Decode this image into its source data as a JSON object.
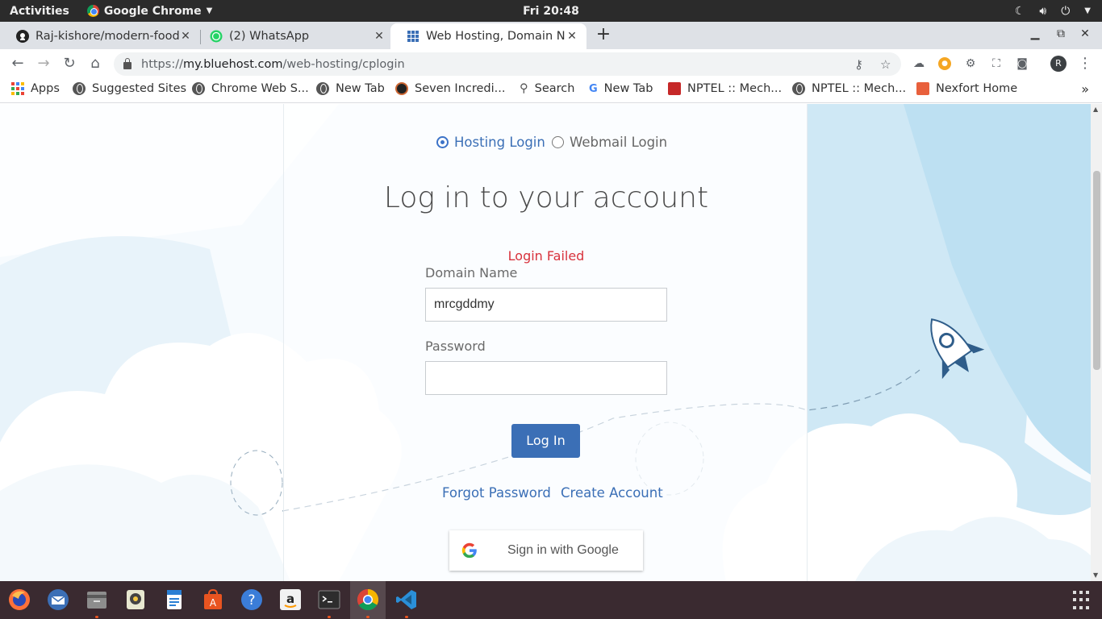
{
  "system_bar": {
    "activities": "Activities",
    "app_name": "Google Chrome",
    "clock": "Fri 20:48"
  },
  "tabs": [
    {
      "title": "Raj-kishore/modern-food",
      "icon": "github-icon"
    },
    {
      "title": "(2) WhatsApp",
      "icon": "whatsapp-icon"
    },
    {
      "title": "Web Hosting, Domain Na",
      "icon": "bluehost-icon",
      "active": true
    }
  ],
  "address_bar": {
    "scheme": "https://",
    "host": "my.bluehost.com",
    "path": "/web-hosting/cplogin"
  },
  "bookmarks": [
    "Apps",
    "Suggested Sites",
    "Chrome Web S...",
    "New Tab",
    "Seven Incredi...",
    "Search",
    "New Tab",
    "NPTEL :: Mech...",
    "NPTEL :: Mech...",
    "Nexfort Home"
  ],
  "login": {
    "radio_hosting": "Hosting Login",
    "radio_webmail": "Webmail Login",
    "selected": "Hosting Login",
    "heading": "Log in to your account",
    "error": "Login Failed",
    "domain_label": "Domain Name",
    "domain_value": "mrcgddmy",
    "password_label": "Password",
    "password_value": "",
    "login_button": "Log In",
    "forgot_link": "Forgot Password",
    "create_link": "Create Account",
    "google_button": "Sign in with Google"
  },
  "profile_initial": "R",
  "colors": {
    "accent": "#3b6fb6",
    "error": "#d8323c",
    "sky": "#cfe8f5"
  }
}
